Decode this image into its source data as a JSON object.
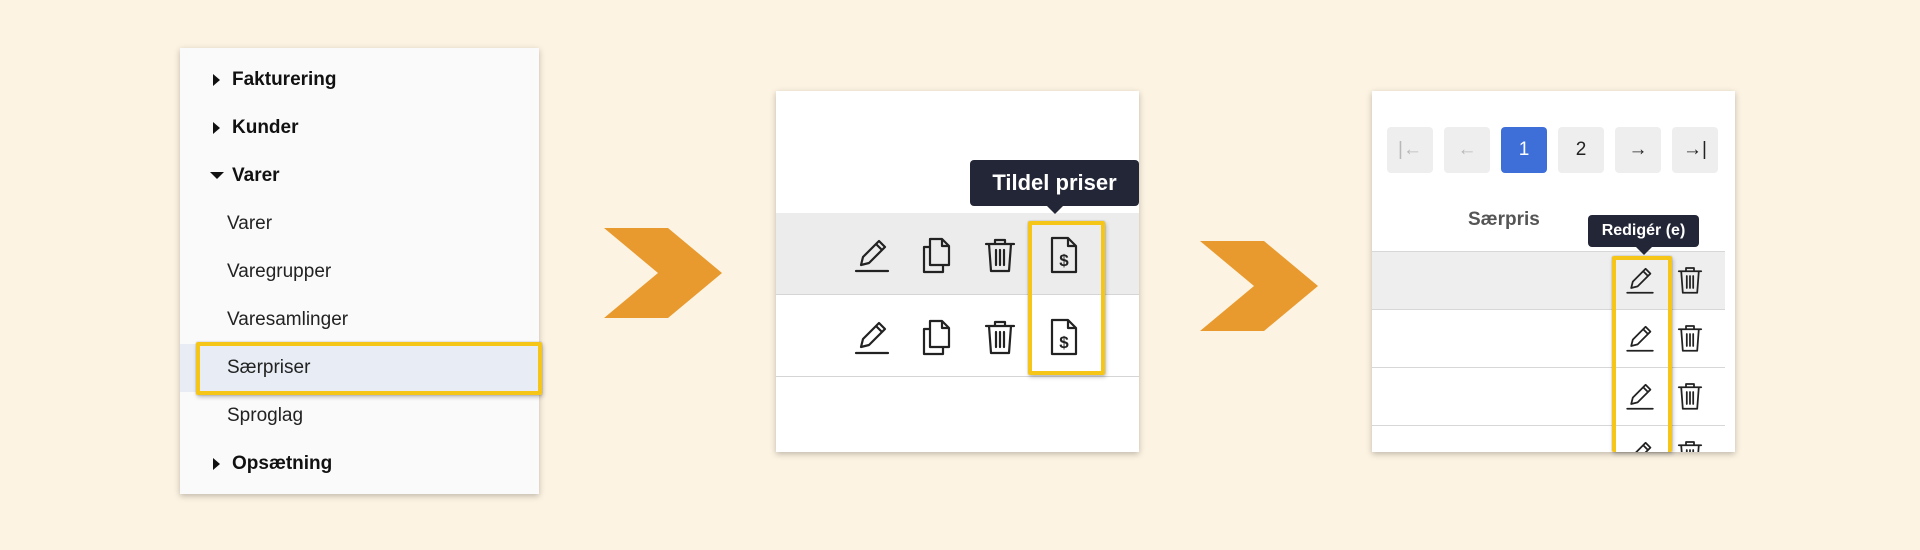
{
  "menu": {
    "items": [
      {
        "label": "Fakturering",
        "kind": "group",
        "expanded": false
      },
      {
        "label": "Kunder",
        "kind": "group",
        "expanded": false
      },
      {
        "label": "Varer",
        "kind": "group",
        "expanded": true
      },
      {
        "label": "Varer",
        "kind": "sub"
      },
      {
        "label": "Varegrupper",
        "kind": "sub"
      },
      {
        "label": "Varesamlinger",
        "kind": "sub"
      },
      {
        "label": "Særpriser",
        "kind": "sub",
        "selected": true
      },
      {
        "label": "Sproglag",
        "kind": "sub"
      },
      {
        "label": "Opsætning",
        "kind": "group",
        "expanded": false
      }
    ]
  },
  "step2": {
    "tooltip": "Tildel priser",
    "row_icons": [
      "edit-icon",
      "copy-icon",
      "delete-icon",
      "assign-price-icon"
    ]
  },
  "step3": {
    "pagination": {
      "first": "|←",
      "prev": "←",
      "pages": [
        "1",
        "2"
      ],
      "current": "1",
      "next": "→",
      "last": "→|"
    },
    "column_header": "Særpris",
    "tooltip": "Redigér (e)",
    "row_icons": [
      "edit-icon",
      "delete-icon"
    ]
  },
  "colors": {
    "background": "#fdf3e2",
    "highlight": "#f5c518",
    "chevron": "#e89a2e",
    "tooltip": "#232637",
    "active_page": "#3e6fd8",
    "selected_item": "#e8edf5"
  }
}
